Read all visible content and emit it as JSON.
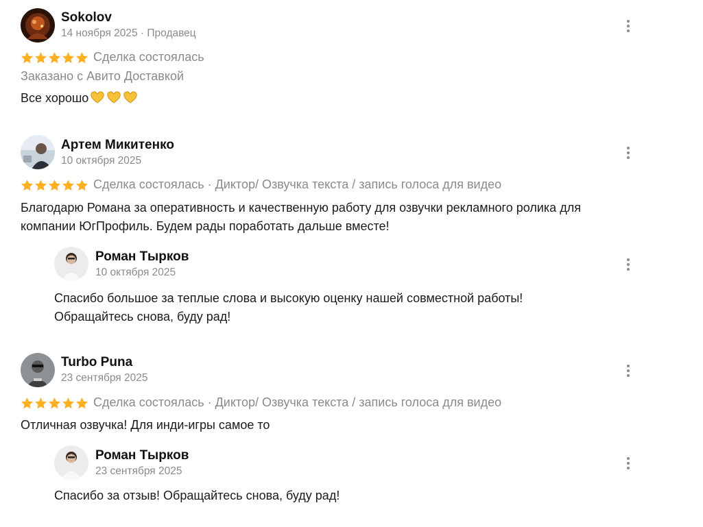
{
  "reviews": [
    {
      "author": "Sokolov",
      "meta": "14 ноября 2025 · Продавец",
      "status": "Сделка состоялась",
      "delivery": "Заказано с Авито Доставкой",
      "text": "Все хорошо",
      "emoji": "heart-hands-icon",
      "rating": 5
    },
    {
      "author": "Артем Микитенко",
      "meta": "10 октября 2025",
      "status": "Сделка состоялась · Диктор/ Озвучка текста / запись голоса для видео",
      "text_lines": [
        "Благодарю Романа за оперативность и качественную работу для озвучки рекламного ролика для",
        "компании ЮгПрофиль. Будем рады поработать дальше вместе!"
      ],
      "rating": 5,
      "reply": {
        "author": "Роман Тырков",
        "meta": "10 октября 2025",
        "text_lines": [
          "Спасибо большое за теплые слова и высокую оценку нашей совместной работы!",
          "Обращайтесь снова, буду рад!"
        ]
      }
    },
    {
      "author": "Turbo Puna",
      "meta": "23 сентября 2025",
      "status": "Сделка состоялась · Диктор/ Озвучка текста / запись голоса для видео",
      "text": "Отличная озвучка! Для инди-игры самое то",
      "rating": 5,
      "reply": {
        "author": "Роман Тырков",
        "meta": "23 сентября 2025",
        "text": "Спасибо за отзыв! Обращайтесь снова, буду рад!"
      }
    }
  ],
  "colors": {
    "star": "#ffb021",
    "muted": "#8a8a8a",
    "text": "#1a1a1a"
  }
}
